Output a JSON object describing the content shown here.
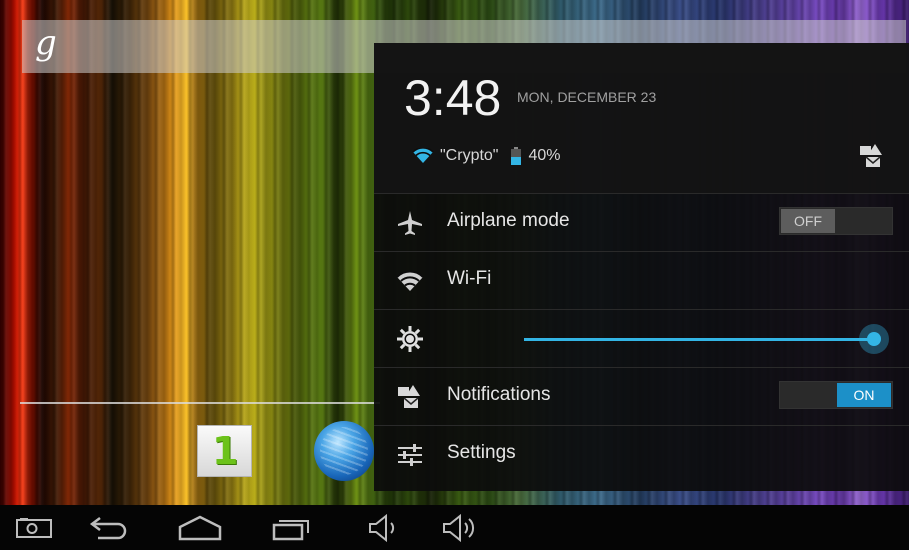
{
  "launcher": {
    "search_icon": "google-g-icon",
    "search_glyph": "g",
    "dock_icons": [
      "app-one-icon",
      "globe-browser-icon"
    ],
    "dock_badge_text": "1"
  },
  "shade": {
    "time": "3:48",
    "date": "MON, DECEMBER 23",
    "wifi_name": "\"Crypto\"",
    "battery": "40%",
    "rows": {
      "airplane": {
        "label": "Airplane mode",
        "toggle": "OFF",
        "icon": "airplane-icon"
      },
      "wifi": {
        "label": "Wi-Fi",
        "icon": "wifi-icon"
      },
      "brightness": {
        "icon": "brightness-icon",
        "level": 1.0
      },
      "notifications": {
        "label": "Notifications",
        "toggle": "ON",
        "icon": "notifications-icon"
      },
      "settings": {
        "label": "Settings",
        "icon": "settings-sliders-icon"
      }
    }
  },
  "navbar": {
    "icons": [
      "screenshot-icon",
      "back-icon",
      "home-icon",
      "recent-apps-icon",
      "volume-down-icon",
      "volume-up-icon"
    ]
  },
  "colors": {
    "accent": "#33b5e5",
    "toggle_on": "#1c90c8",
    "shade_bg": "#0c0c0c"
  }
}
